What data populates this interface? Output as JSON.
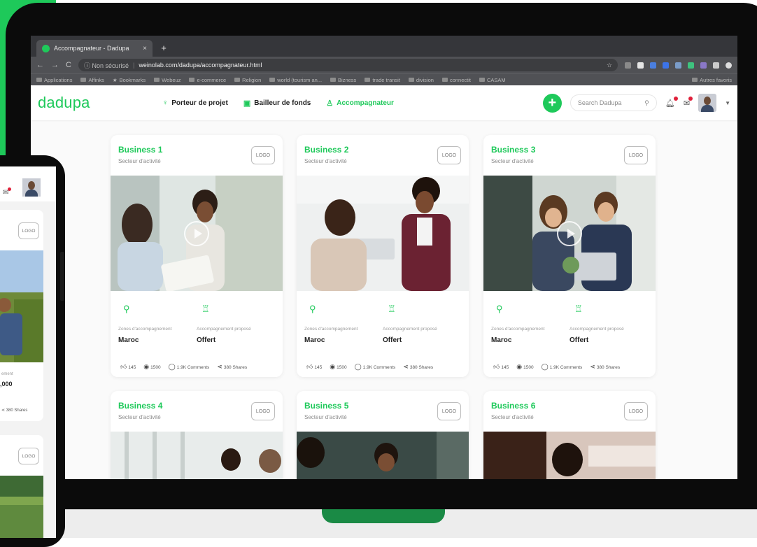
{
  "browser": {
    "tab_title": "Accompagnateur - Dadupa",
    "tab_close": "×",
    "new_tab": "+",
    "back": "←",
    "forward": "→",
    "reload": "C",
    "security": "ⓘ Non sécurisé",
    "url": "weinolab.com/dadupa/accompagnateur.html",
    "bookmarks": [
      "Applications",
      "Affinks",
      "Bookmarks",
      "Webeuz",
      "e-commerce",
      "Religion",
      "world (tourism an...",
      "Bizness",
      "trade transit",
      "division",
      "connectit",
      "CASAM"
    ],
    "other_bookmarks": "Autres favoris"
  },
  "header": {
    "logo": "dadupa",
    "nav": [
      {
        "label": "Porteur de projet",
        "icon": "lightbulb-icon"
      },
      {
        "label": "Bailleur de fonds",
        "icon": "money-icon"
      },
      {
        "label": "Accompagnateur",
        "icon": "people-icon"
      }
    ],
    "search_placeholder": "Search Dadupa",
    "accent": "#1ec95a"
  },
  "cards": [
    {
      "title": "Business 1",
      "subtitle": "Secteur d'activité",
      "logo": "LOGO",
      "zone_label": "Zones d'accompagnement",
      "zone_value": "Maroc",
      "offer_label": "Accompagnement proposé",
      "offer_value": "Offert",
      "likes": "145",
      "views": "1500",
      "comments": "1.9K Comments",
      "shares": "380 Shares"
    },
    {
      "title": "Business 2",
      "subtitle": "Secteur d'activité",
      "logo": "LOGO",
      "zone_label": "Zones d'accompagnement",
      "zone_value": "Maroc",
      "offer_label": "Accompagnement proposé",
      "offer_value": "Offert",
      "likes": "145",
      "views": "1500",
      "comments": "1.9K Comments",
      "shares": "380 Shares"
    },
    {
      "title": "Business 3",
      "subtitle": "Secteur d'activité",
      "logo": "LOGO",
      "zone_label": "Zones d'accompagnement",
      "zone_value": "Maroc",
      "offer_label": "Accompagnement proposé",
      "offer_value": "Offert",
      "likes": "145",
      "views": "1500",
      "comments": "1.9K Comments",
      "shares": "380 Shares"
    },
    {
      "title": "Business 4",
      "subtitle": "Secteur d'activité",
      "logo": "LOGO"
    },
    {
      "title": "Business 5",
      "subtitle": "Secteur d'activité",
      "logo": "LOGO"
    },
    {
      "title": "Business 6",
      "subtitle": "Secteur d'activité",
      "logo": "LOGO"
    }
  ],
  "phone": {
    "logo1": "LOGO",
    "label_partial": "ement",
    "value_partial": ",000",
    "shares": "380 Shares",
    "logo2": "LOGO"
  }
}
